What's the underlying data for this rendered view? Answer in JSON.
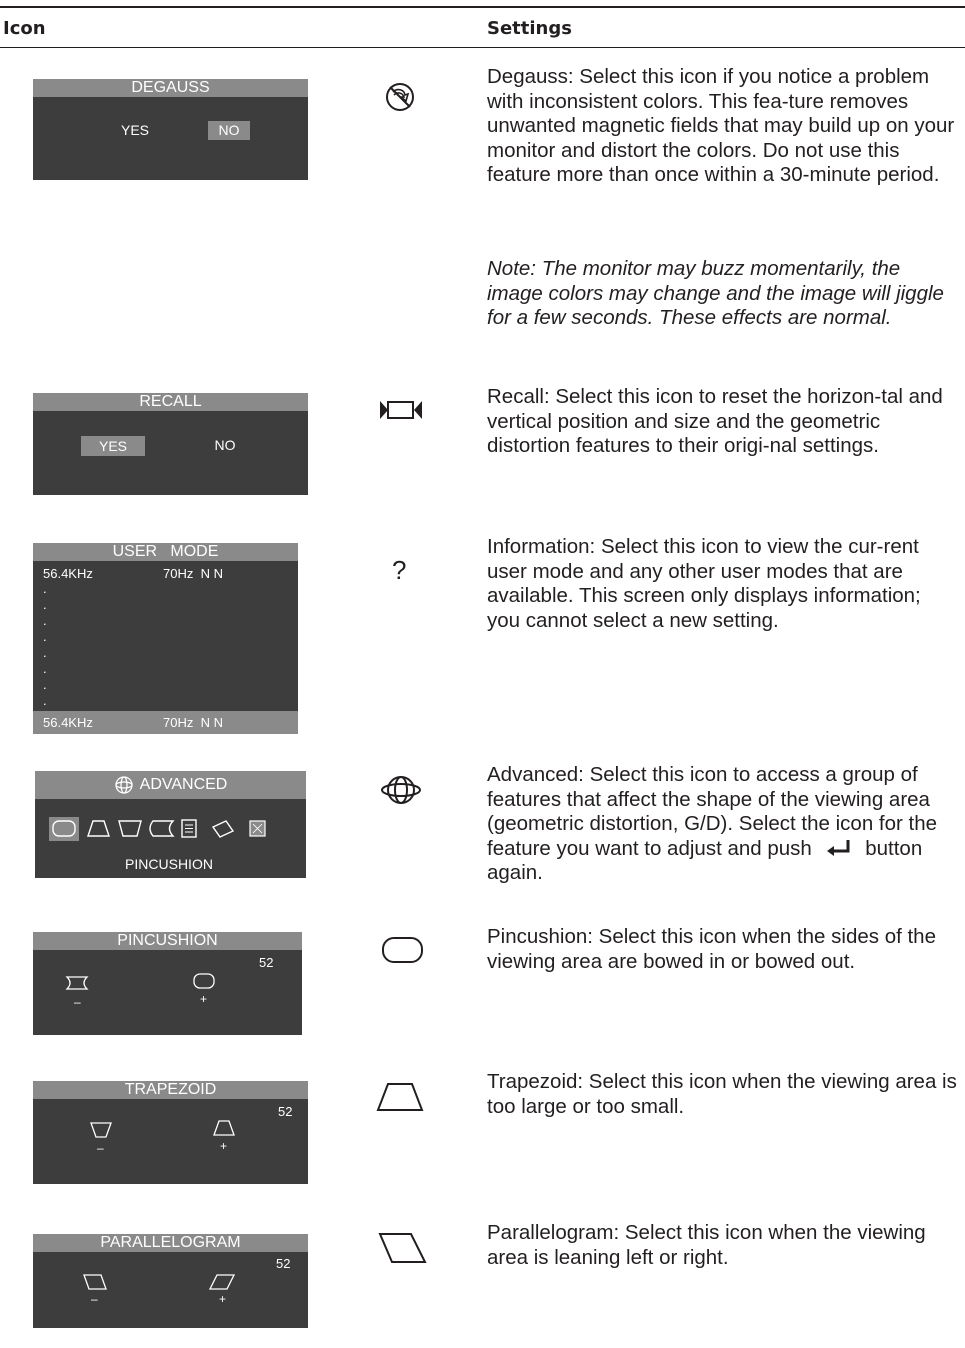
{
  "header": {
    "icon_col": "Icon",
    "settings_col": "Settings"
  },
  "degauss": {
    "osd_title": "DEGAUSS",
    "opt_yes": "YES",
    "opt_no": "NO",
    "icon": "degauss-icon",
    "desc": "Degauss: Select this icon if you notice a problem with inconsistent colors. This fea-ture removes unwanted magnetic fields that may build up on your monitor and distort the colors. Do not use this feature more than once within a 30-minute period.",
    "note": "Note: The monitor may buzz momentarily, the image colors may change and the image will jiggle for a few seconds. These effects are normal."
  },
  "recall": {
    "osd_title": "RECALL",
    "opt_yes": "YES",
    "opt_no": "NO",
    "icon": "recall-icon",
    "desc": "Recall: Select this icon to reset the horizon-tal and vertical position and size and the geometric distortion features to their origi-nal settings."
  },
  "information": {
    "osd_title": "USER   MODE",
    "first_freq": "56.4KHz",
    "first_rate": "70Hz  N N",
    "last_freq": "56.4KHz",
    "last_rate": "70Hz  N N",
    "icon_glyph": "?",
    "desc": "Information: Select this icon to view the cur-rent user mode and any other user modes that are available. This screen only displays information; you cannot select a new setting."
  },
  "advanced": {
    "osd_title": "ADVANCED",
    "selected": "PINCUSHION",
    "icon": "advanced-icon",
    "desc_before": "Advanced: Select this icon to access a group of features that affect the shape of the viewing area (geometric distortion, G/D). Select the icon for the feature you want to adjust and push",
    "desc_after": "button again."
  },
  "pincushion": {
    "osd_title": "PINCUSHION",
    "value": "52",
    "minus": "–",
    "plus": "+",
    "icon": "pincushion-icon",
    "desc": "Pincushion: Select this icon when the sides of the viewing area are bowed in or bowed out."
  },
  "trapezoid": {
    "osd_title": "TRAPEZOID",
    "value": "52",
    "minus": "–",
    "plus": "+",
    "icon": "trapezoid-icon",
    "desc": "Trapezoid: Select this icon when the viewing area is too large or too small."
  },
  "parallelogram": {
    "osd_title": "PARALLELOGRAM",
    "value": "52",
    "minus": "–",
    "plus": "+",
    "icon": "parallelogram-icon",
    "desc": "Parallelogram: Select this icon when the viewing area is leaning left or right."
  },
  "colors": {
    "osd_bg": "#3d3d3d",
    "osd_bar": "#8a8a8a",
    "text": "#231f20"
  }
}
